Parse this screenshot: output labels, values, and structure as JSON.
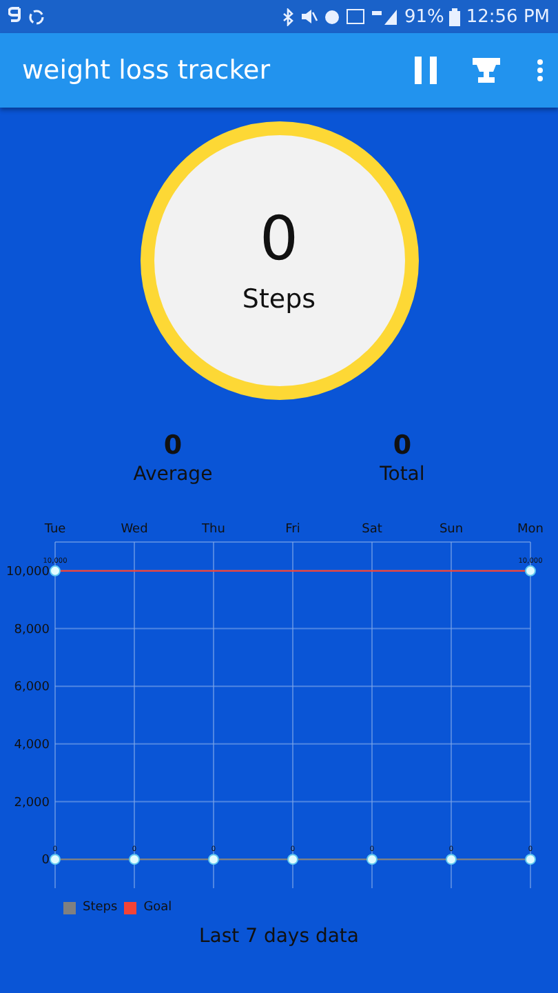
{
  "status_bar": {
    "battery": "91%",
    "time": "12:56 PM"
  },
  "app_bar": {
    "title": "weight loss tracker"
  },
  "today": {
    "value": "0",
    "label": "Steps"
  },
  "stats": [
    {
      "value": "0",
      "label": "Average"
    },
    {
      "value": "0",
      "label": "Total"
    }
  ],
  "chart": {
    "chart_data": {
      "type": "line",
      "grid": true,
      "categories": [
        "Tue",
        "Wed",
        "Thu",
        "Fri",
        "Sat",
        "Sun",
        "Mon"
      ],
      "ylim": [
        -1000,
        11000
      ],
      "yticks": [
        {
          "value": 0,
          "label": "0"
        },
        {
          "value": 2000,
          "label": "2,000"
        },
        {
          "value": 4000,
          "label": "4,000"
        },
        {
          "value": 6000,
          "label": "6,000"
        },
        {
          "value": 8000,
          "label": "8,000"
        },
        {
          "value": 10000,
          "label": "10,000"
        }
      ],
      "series": [
        {
          "name": "Steps",
          "color": "#808080",
          "marker": "circle",
          "values": [
            0,
            0,
            0,
            0,
            0,
            0,
            0
          ],
          "value_labels": [
            "0",
            "0",
            "0",
            "0",
            "0",
            "0",
            "0"
          ]
        },
        {
          "name": "Goal",
          "color": "#f44336",
          "marker": "circle",
          "values": [
            10000,
            null,
            null,
            null,
            null,
            null,
            10000
          ],
          "value_labels": [
            "10,000",
            null,
            null,
            null,
            null,
            null,
            "10,000"
          ]
        }
      ]
    },
    "caption": "Last 7 days data"
  }
}
